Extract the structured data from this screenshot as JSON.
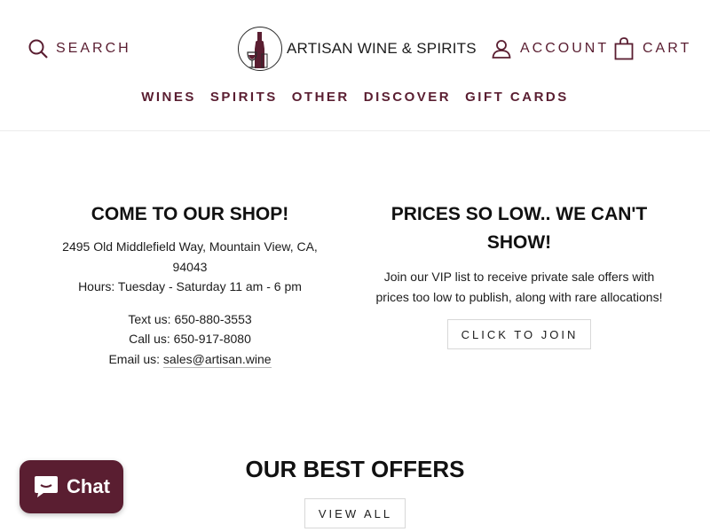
{
  "header": {
    "search_label": "SEARCH",
    "logo_text": "ARTISAN WINE & SPIRITS",
    "account_label": "ACCOUNT",
    "cart_label": "CART"
  },
  "nav": {
    "items": [
      "WINES",
      "SPIRITS",
      "OTHER",
      "DISCOVER",
      "GIFT CARDS"
    ]
  },
  "shop": {
    "title": "COME TO OUR SHOP!",
    "address_line1": "2495 Old Middlefield Way, Mountain View, CA,",
    "address_line2": "94043",
    "hours": "Hours: Tuesday - Saturday 11 am - 6 pm",
    "text_us": "Text us: 650-880-3553",
    "call_us": "Call us: 650-917-8080",
    "email_prefix": "Email us: ",
    "email": "sales@artisan.wine"
  },
  "vip": {
    "title_line1": "PRICES SO LOW.. WE CAN'T",
    "title_line2": "SHOW!",
    "desc_line1": "Join our VIP list to receive private sale offers with",
    "desc_line2": "prices too low to publish, along with rare allocations!",
    "button_label": "CLICK TO JOIN"
  },
  "offers": {
    "title": "OUR BEST OFFERS",
    "button_label": "VIEW ALL"
  },
  "chat": {
    "label": "Chat"
  },
  "colors": {
    "brand": "#5a1e31",
    "text": "#1c1c1c"
  },
  "icons": [
    "search-icon",
    "user-icon",
    "shopping-bag-icon",
    "wine-bottle-logo",
    "chat-bubble-icon"
  ]
}
